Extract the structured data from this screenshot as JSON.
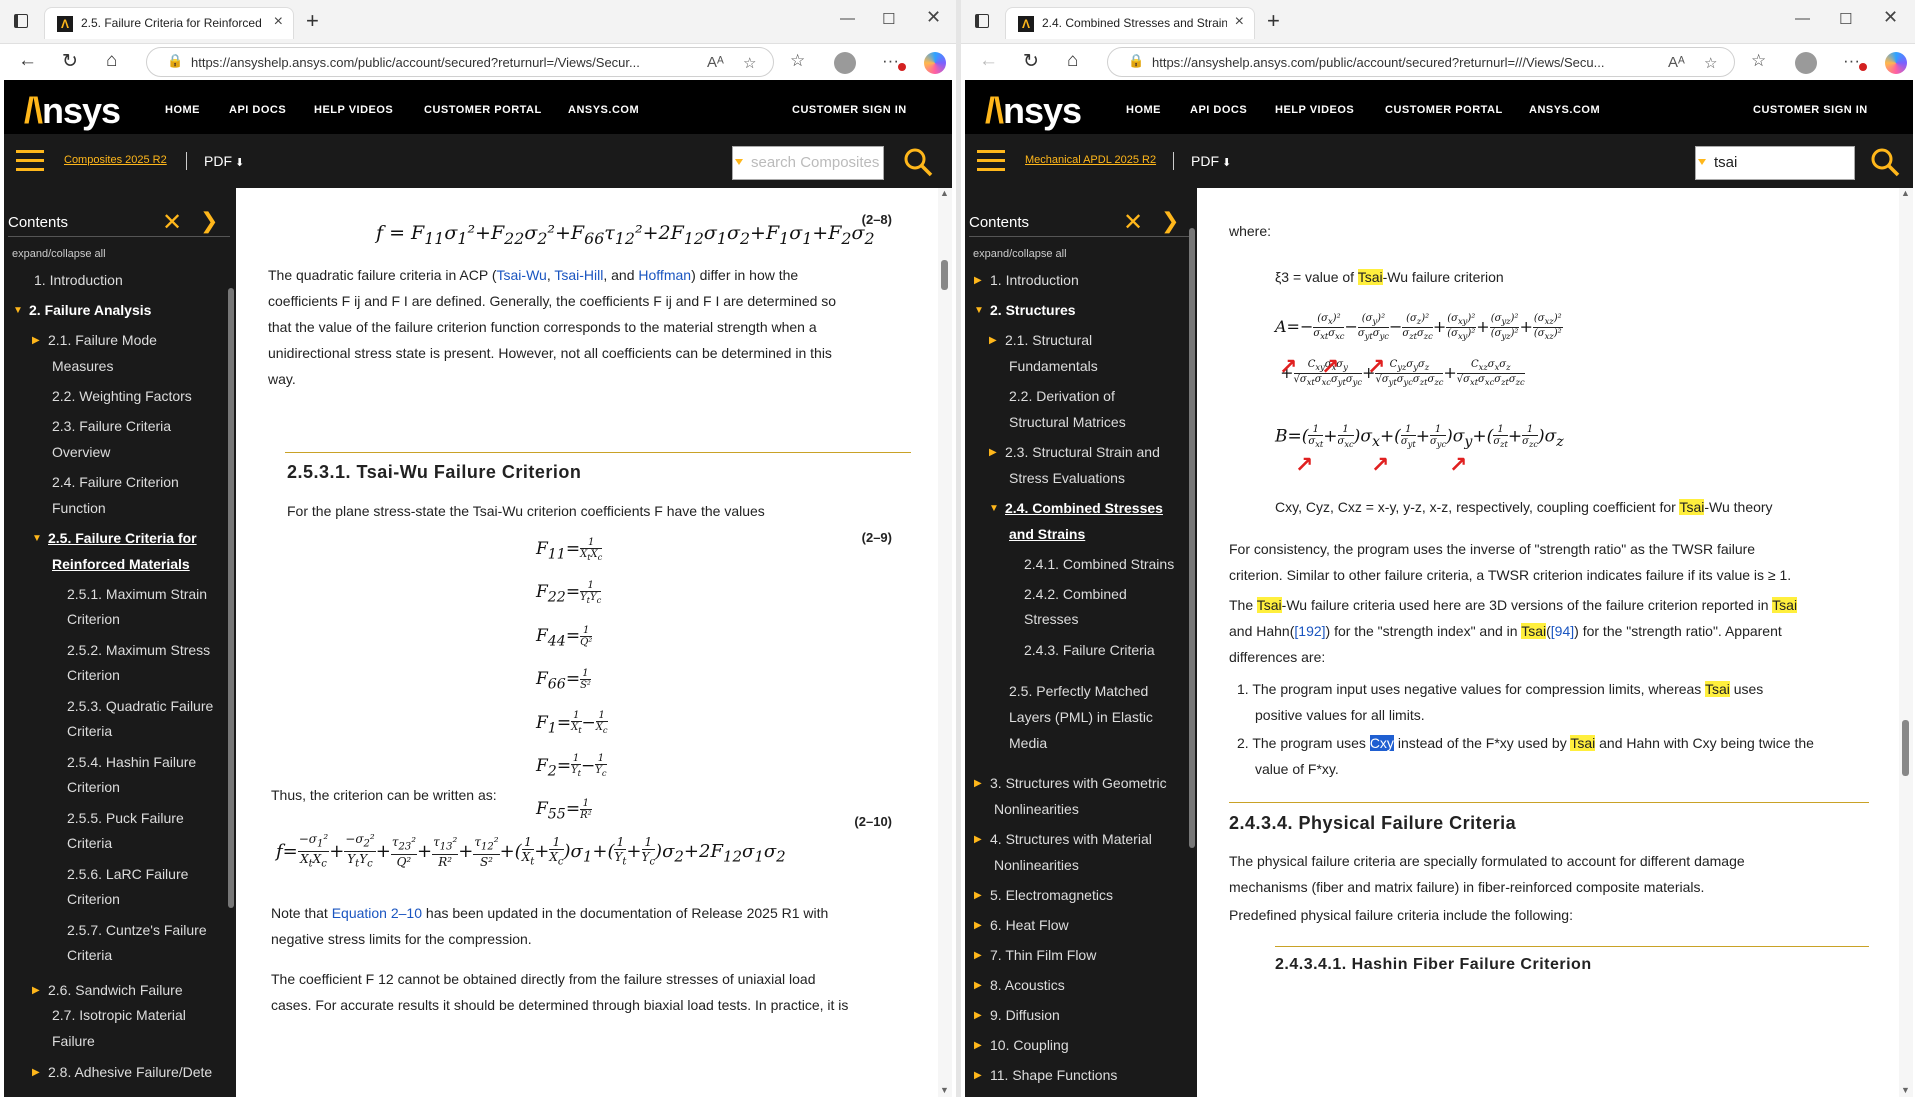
{
  "left": {
    "tab_title": "2.5. Failure Criteria for Reinforced",
    "url": "https://ansyshelp.ansys.com/public/account/secured?returnurl=/Views/Secur...",
    "nav": [
      "HOME",
      "API DOCS",
      "HELP VIDEOS",
      "CUSTOMER PORTAL",
      "ANSYS.COM"
    ],
    "signin": "CUSTOMER SIGN IN",
    "book": "Composites 2025 R2",
    "pdf": "PDF",
    "search_placeholder": "search Composites",
    "search_value": "",
    "sidebar_title": "Contents",
    "expand": "expand/collapse all",
    "toc": [
      "1. Introduction",
      "2. Failure Analysis",
      "2.1. Failure Mode",
      "Measures",
      "2.2. Weighting Factors",
      "2.3. Failure Criteria",
      "Overview",
      "2.4. Failure Criterion",
      "Function",
      "2.5. Failure Criteria for",
      "Reinforced Materials",
      "2.5.1. Maximum Strain",
      "Criterion",
      "2.5.2. Maximum Stress",
      "Criterion",
      "2.5.3. Quadratic Failure",
      "Criteria",
      "2.5.4. Hashin Failure",
      "Criterion",
      "2.5.5. Puck Failure",
      "Criteria",
      "2.5.6. LaRC Failure",
      "Criterion",
      "2.5.7. Cuntze's Failure",
      "Criteria",
      "2.6. Sandwich Failure",
      "2.7. Isotropic Material",
      "Failure",
      "2.8. Adhesive Failure/Dete"
    ],
    "eq_label_8": "(2–8)",
    "eq_label_9": "(2–9)",
    "eq_label_10": "(2–10)",
    "p1_a": "The quadratic failure criteria in ACP (",
    "p1_link1": "Tsai-Wu",
    "p1_b": ", ",
    "p1_link2": "Tsai-Hill",
    "p1_c": ", and ",
    "p1_link3": "Hoffman",
    "p1_d": ") differ in how the",
    "p1_line2": "coefficients F ij and F I are defined. Generally, the coefficients F ij and F I are determined so",
    "p1_line3": "that the value of the failure criterion function corresponds to the material strength when a",
    "p1_line4": "unidirectional stress state is present. However, not all coefficients can be determined in this",
    "p1_line5": "way.",
    "h_tsaiwu": "2.5.3.1. Tsai-Wu Failure Criterion",
    "p2": "For the plane stress-state the Tsai-Wu criterion coefficients F have the values",
    "p3": "Thus, the criterion can be written as:",
    "p4_a": "Note that ",
    "p4_link": "Equation 2–10",
    "p4_b": " has been updated in the documentation of Release 2025 R1 with",
    "p4_line2": "negative stress limits for the compression.",
    "p5_line1": "The coefficient F 12 cannot be obtained directly from the failure stresses of uniaxial load",
    "p5_line2": "cases. For accurate results it should be determined through biaxial load tests. In practice, it is"
  },
  "right": {
    "tab_title": "2.4. Combined Stresses and Strain",
    "url": "https://ansyshelp.ansys.com/public/account/secured?returnurl=///Views/Secu...",
    "nav": [
      "HOME",
      "API DOCS",
      "HELP VIDEOS",
      "CUSTOMER PORTAL",
      "ANSYS.COM"
    ],
    "signin": "CUSTOMER SIGN IN",
    "book": "Mechanical APDL 2025 R2",
    "pdf": "PDF",
    "search_value": "tsai",
    "sidebar_title": "Contents",
    "expand": "expand/collapse all",
    "toc": [
      "1. Introduction",
      "2. Structures",
      "2.1. Structural",
      "Fundamentals",
      "2.2. Derivation of",
      "Structural Matrices",
      "2.3. Structural Strain and",
      "Stress Evaluations",
      "2.4. Combined Stresses",
      "and Strains",
      "2.4.1. Combined Strains",
      "2.4.2. Combined",
      "Stresses",
      "2.4.3. Failure Criteria",
      "2.5. Perfectly Matched",
      "Layers (PML) in Elastic",
      "Media",
      "3. Structures with Geometric",
      "Nonlinearities",
      "4. Structures with Material",
      "Nonlinearities",
      "5. Electromagnetics",
      "6. Heat Flow",
      "7. Thin Film Flow",
      "8. Acoustics",
      "9. Diffusion",
      "10. Coupling",
      "11. Shape Functions"
    ],
    "where": "where:",
    "xi_a": "ξ3 = value of ",
    "xi_hl": "Tsai",
    "xi_b": "-Wu failure criterion",
    "cxy_a": "Cxy, Cyz, Cxz = x-y, y-z, x-z, respectively, coupling coefficient for ",
    "cxy_hl": "Tsai",
    "cxy_b": "-Wu theory",
    "p1_line1": "For consistency, the program uses the inverse of \"strength ratio\" as the TWSR failure",
    "p1_line2": "criterion. Similar to other failure criteria, a TWSR criterion indicates failure if its value is ≥ 1.",
    "p2_a": "The ",
    "p2_hl1": "Tsai",
    "p2_b": "-Wu failure criteria used here are 3D versions of the failure criterion reported in ",
    "p2_hl2": "Tsai",
    "p2_c": "and Hahn(",
    "p2_ref1": "[192]",
    "p2_d": ") for the \"strength index\" and in ",
    "p2_hl3": "Tsai",
    "p2_e": "(",
    "p2_ref2": "[94]",
    "p2_f": ") for the \"strength ratio\". Apparent",
    "p2_g": "differences are:",
    "li1_a": "1. The program input uses negative values for compression limits, whereas ",
    "li1_hl": "Tsai",
    "li1_b": " uses",
    "li1_c": "positive values for all limits.",
    "li2_a": "2. The program uses ",
    "li2_sel": "Cxy",
    "li2_b": " instead of the F*xy used by ",
    "li2_hl": "Tsai",
    "li2_c": " and Hahn with Cxy being twice the",
    "li2_d": "value of F*xy.",
    "h_phys": "2.4.3.4. Physical Failure Criteria",
    "p3_line1": "The physical failure criteria are specially formulated to account for different damage",
    "p3_line2": "mechanisms (fiber and matrix failure) in fiber-reinforced composite materials.",
    "p4": "Predefined physical failure criteria include the following:",
    "h_hashin": "2.4.3.4.1. Hashin Fiber Failure Criterion"
  },
  "colors": {
    "accent": "#ffb71b",
    "highlight": "#ffef3d",
    "link": "#1a55c0"
  }
}
